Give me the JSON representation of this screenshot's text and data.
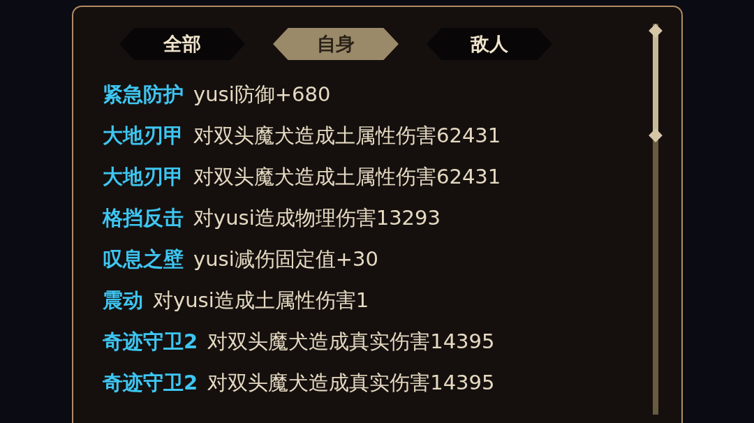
{
  "tabs": [
    {
      "label": "全部",
      "selected": false
    },
    {
      "label": "自身",
      "selected": true
    },
    {
      "label": "敌人",
      "selected": false
    }
  ],
  "log": [
    {
      "skill": "紧急防护",
      "effect": "yusi防御+680"
    },
    {
      "skill": "大地刃甲",
      "effect": "对双头魔犬造成土属性伤害62431"
    },
    {
      "skill": "大地刃甲",
      "effect": "对双头魔犬造成土属性伤害62431"
    },
    {
      "skill": "格挡反击",
      "effect": "对yusi造成物理伤害13293"
    },
    {
      "skill": "叹息之壁",
      "effect": "yusi减伤固定值+30"
    },
    {
      "skill": "震动",
      "effect": "对yusi造成土属性伤害1"
    },
    {
      "skill": "奇迹守卫2",
      "effect": "对双头魔犬造成真实伤害14395"
    },
    {
      "skill": "奇迹守卫2",
      "effect": "对双头魔犬造成真实伤害14395"
    }
  ]
}
